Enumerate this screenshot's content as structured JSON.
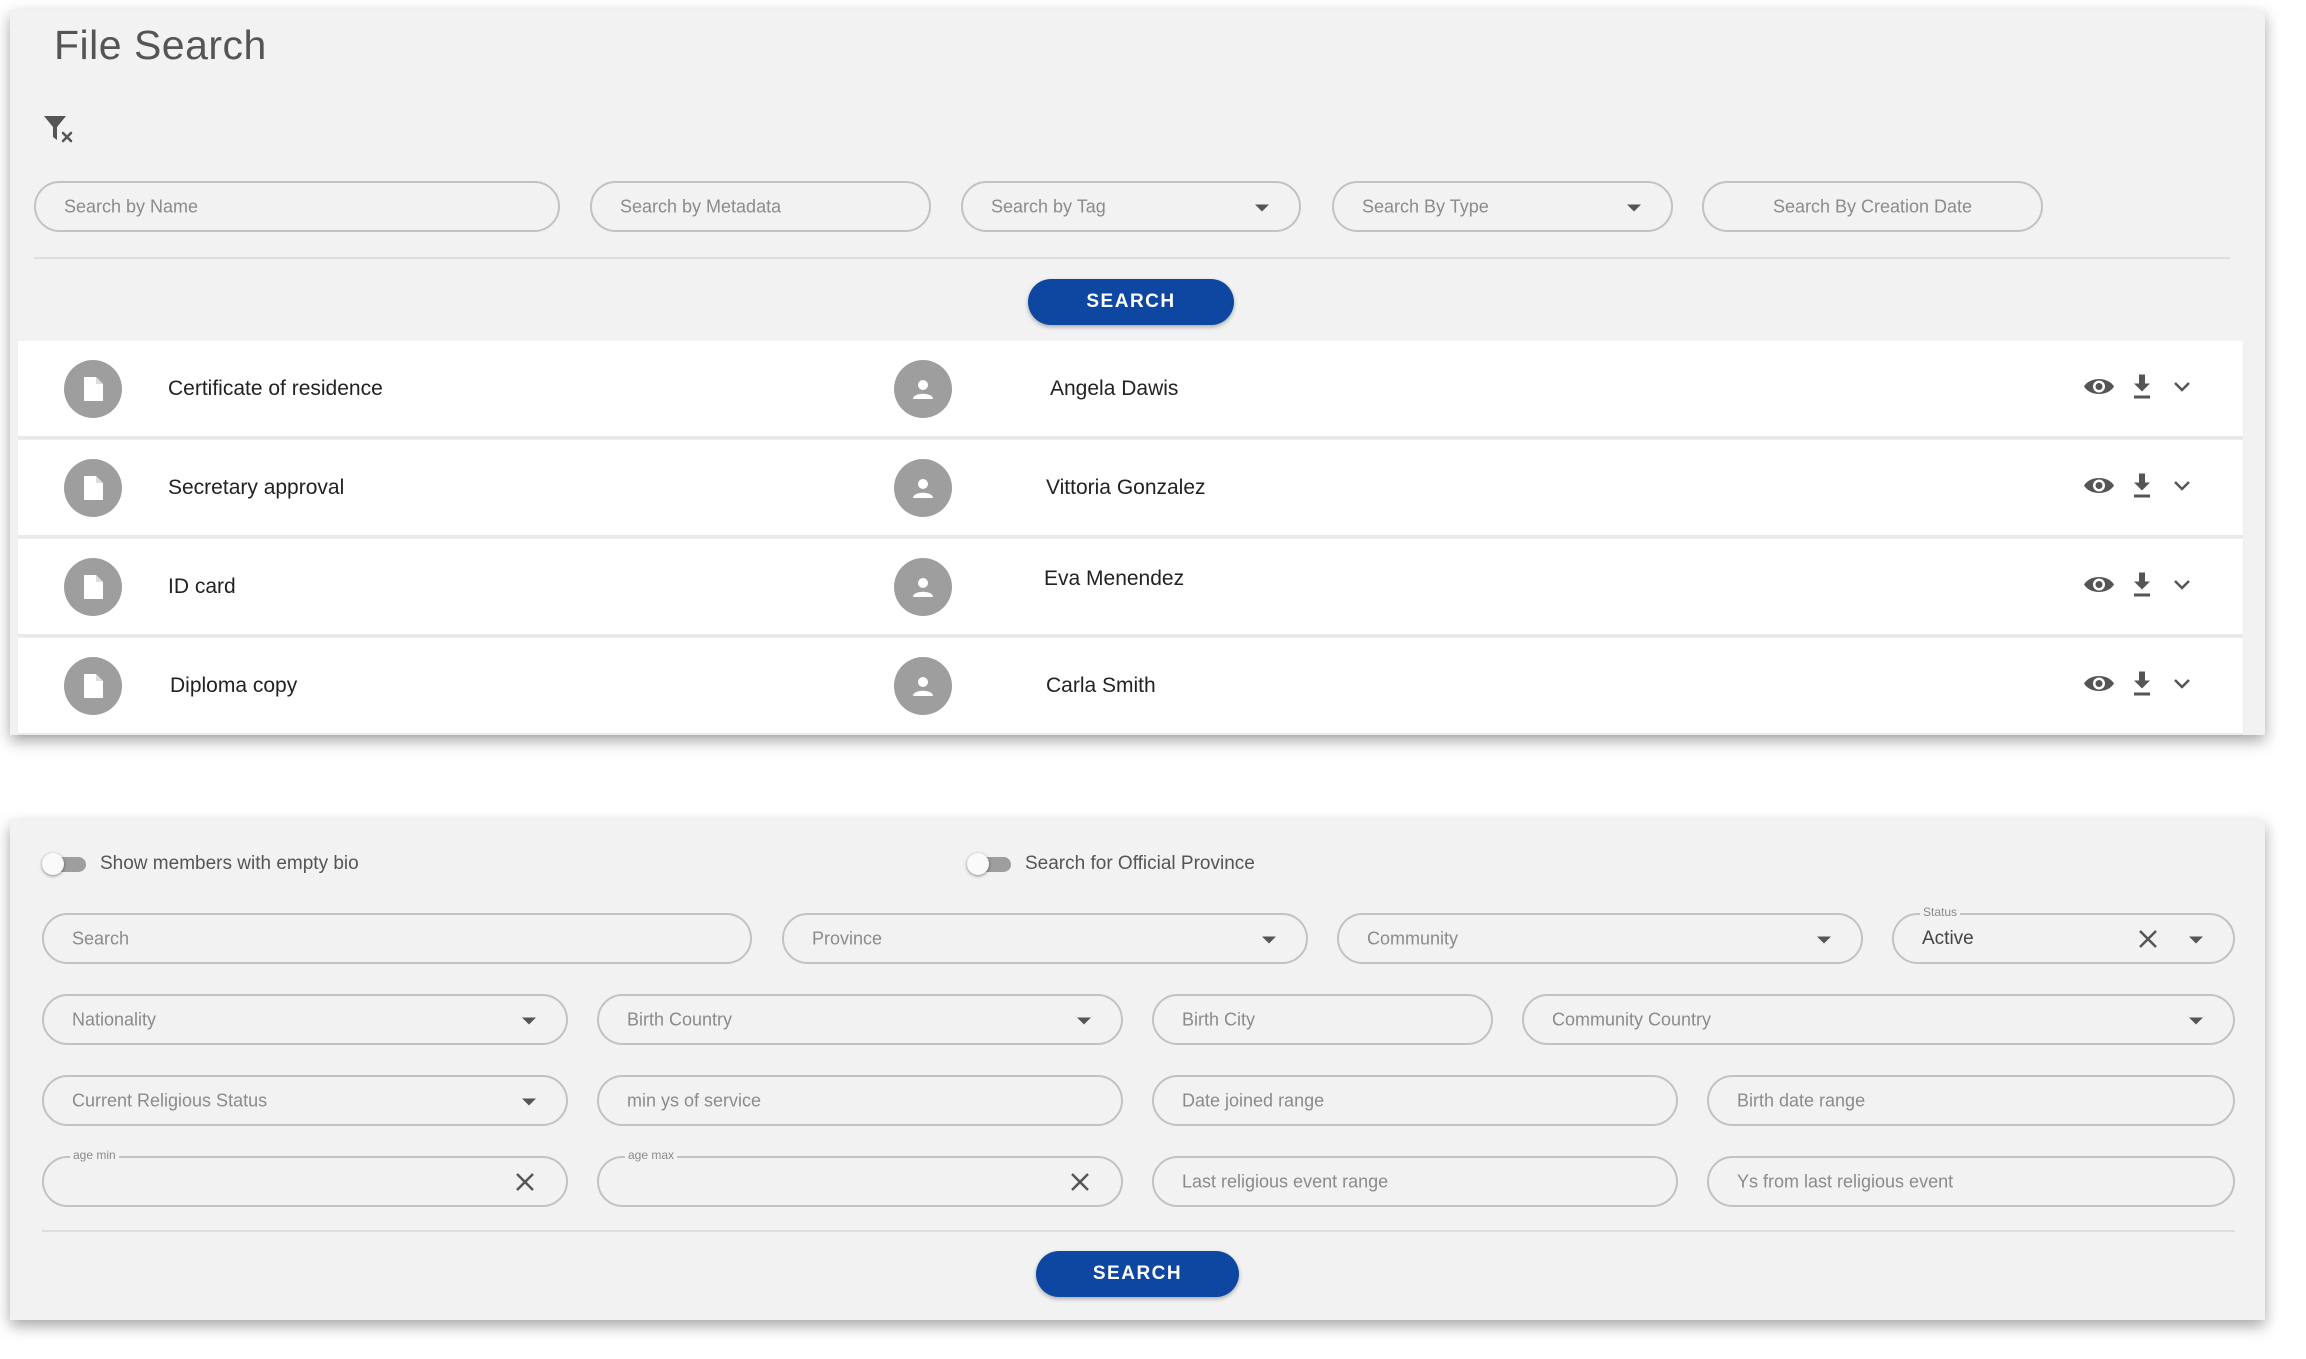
{
  "file_search": {
    "title": "File Search",
    "filters": {
      "name_placeholder": "Search by Name",
      "metadata_placeholder": "Search by Metadata",
      "tag_placeholder": "Search by Tag",
      "type_placeholder": "Search By Type",
      "date_placeholder": "Search By Creation Date"
    },
    "search_label": "SEARCH",
    "results": [
      {
        "file": "Certificate of residence",
        "owner": "Angela Dawis"
      },
      {
        "file": "Secretary approval",
        "owner": "Vittoria Gonzalez"
      },
      {
        "file": "ID card",
        "owner": "Eva Menendez"
      },
      {
        "file": "Diploma copy",
        "owner": "Carla Smith"
      }
    ],
    "icons": [
      "filter-clear-icon",
      "file-icon",
      "person-icon",
      "eye-icon",
      "download-icon",
      "chevron-down-icon"
    ]
  },
  "member_search": {
    "toggles": {
      "empty_bio": "Show members with empty bio",
      "official_province": "Search for Official Province"
    },
    "fields": {
      "search": "Search",
      "province": "Province",
      "community": "Community",
      "status_label": "Status",
      "status_value": "Active",
      "nationality": "Nationality",
      "birth_country": "Birth Country",
      "birth_city": "Birth City",
      "community_country": "Community Country",
      "current_religious_status": "Current Religious Status",
      "min_years_service": "min ys of service",
      "date_joined_range": "Date joined range",
      "birth_date_range": "Birth date range",
      "age_min_label": "age min",
      "age_max_label": "age max",
      "last_religious_event_range": "Last religious event range",
      "years_from_last_event": "Ys from last religious event"
    },
    "search_label": "SEARCH"
  },
  "colors": {
    "primary_button": "#0d47a1",
    "panel_bg": "#f2f2f2",
    "avatar_bg": "#9e9e9e"
  }
}
